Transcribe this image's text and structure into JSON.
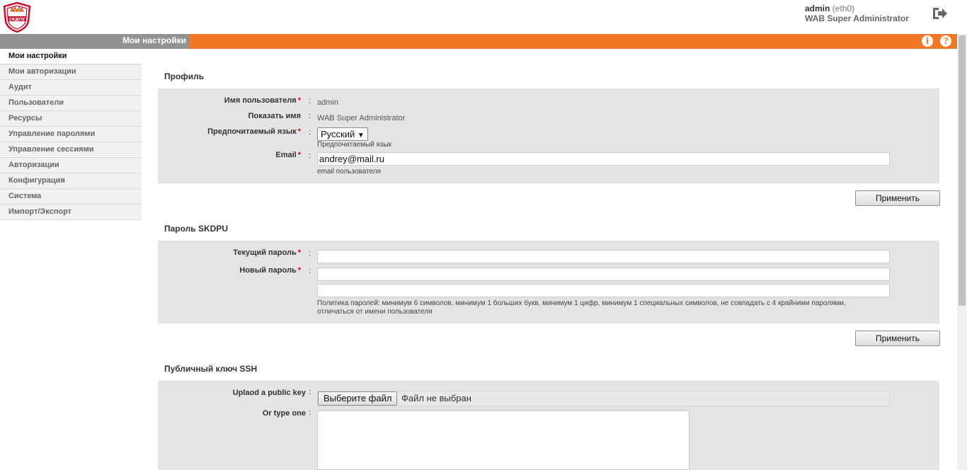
{
  "header": {
    "logo_text": "СКДПУ",
    "user_name": "admin",
    "interface": "(eth0)",
    "role": "WAB Super Administrator",
    "logout_icon": "logout-icon"
  },
  "titlebar": {
    "title": "Мои настройки",
    "info_icon": "info-icon",
    "help_icon": "help-icon"
  },
  "sidebar": {
    "items": [
      {
        "label": "Мои настройки"
      },
      {
        "label": "Мои авторизации"
      },
      {
        "label": "Аудит"
      },
      {
        "label": "Пользователи"
      },
      {
        "label": "Ресурсы"
      },
      {
        "label": "Управление паролями"
      },
      {
        "label": "Управление сессиями"
      },
      {
        "label": "Авторизации"
      },
      {
        "label": "Конфигурация"
      },
      {
        "label": "Система"
      },
      {
        "label": "Импорт/Экспорт"
      }
    ]
  },
  "profile": {
    "title": "Профиль",
    "username_label": "Имя пользователя",
    "username_value": "admin",
    "display_label": "Показать имя",
    "display_value": "WAB Super Administrator",
    "language_label": "Предпочитаемый язык",
    "language_value": "Русский",
    "language_hint": "Предпочитаемый язык",
    "email_label": "Email",
    "email_value": "andrey@mail.ru",
    "email_hint": "email пользователя",
    "apply_label": "Применить"
  },
  "password": {
    "title": "Пароль SKDPU",
    "current_label": "Текущий пароль",
    "new_label": "Новый пароль",
    "policy": "Политика паролей: минимум 6 символов, минимум 1 больших букв, минимум 1 цифр, минимум 1 специальных символов, не совпадать с 4 крайними паролями,",
    "policy_line2": "отличаться от имени пользователя",
    "apply_label": "Применить"
  },
  "ssh": {
    "title": "Публичный ключ SSH",
    "upload_label": "Uplaod a public key",
    "choose_file": "Выберите файл",
    "no_file": "Файл не выбран",
    "type_label": "Or type one"
  },
  "colors": {
    "accent": "#f07827",
    "panel": "#e4e4e4",
    "required": "#dd0000"
  }
}
